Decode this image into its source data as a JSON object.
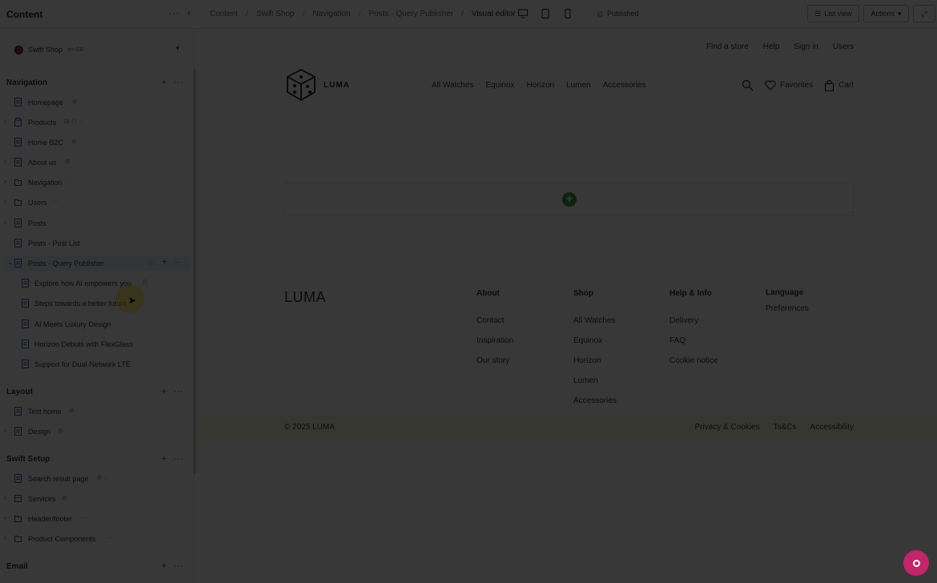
{
  "topbar": {
    "title": "Content",
    "breadcrumbs": [
      "Content",
      "Swift Shop",
      "Navigation",
      "Posts - Query Publisher",
      "Visual editor"
    ],
    "status": "Published",
    "list_view_label": "List view",
    "actions_label": "Actions"
  },
  "sidebar": {
    "site": {
      "name": "Swift Shop",
      "lang": "en-GB"
    },
    "sections": [
      {
        "label": "Navigation"
      },
      {
        "label": "Layout"
      },
      {
        "label": "Swift Setup"
      },
      {
        "label": "Email"
      }
    ],
    "items": [
      {
        "label": "Homepage",
        "icon": "page-icon"
      },
      {
        "label": "Products",
        "icon": "shop-icon"
      },
      {
        "label": "Home B2C",
        "icon": "page-icon"
      },
      {
        "label": "About us",
        "icon": "page-icon"
      },
      {
        "label": "Navigation",
        "icon": "folder-icon"
      },
      {
        "label": "Users",
        "icon": "folder-icon"
      },
      {
        "label": "Posts",
        "icon": "page-icon"
      },
      {
        "label": "Posts - Post List",
        "icon": "page-icon"
      },
      {
        "label": "Posts - Query Publisher",
        "icon": "page-icon"
      },
      {
        "label": "Explore how AI empowers you",
        "icon": "page-icon"
      },
      {
        "label": "Steps towards a better future",
        "icon": "page-icon"
      },
      {
        "label": "AI Meets Luxury Design",
        "icon": "page-icon"
      },
      {
        "label": "Horizon Debuts with FlexGlass",
        "icon": "page-icon"
      },
      {
        "label": "Support for Dual-Network LTE",
        "icon": "page-icon"
      },
      {
        "label": "Test home",
        "icon": "page-icon"
      },
      {
        "label": "Design",
        "icon": "page-icon"
      },
      {
        "label": "Search result page",
        "icon": "page-icon"
      },
      {
        "label": "Services",
        "icon": "services-icon"
      },
      {
        "label": "Header/footer",
        "icon": "folder-icon"
      },
      {
        "label": "Product Components",
        "icon": "folder-icon"
      }
    ]
  },
  "preview": {
    "utility_links": [
      "Find a store",
      "Help",
      "Sign in",
      "Users"
    ],
    "brand": "LUMA",
    "nav": [
      "All Watches",
      "Equinox",
      "Horizon",
      "Lumen",
      "Accessories"
    ],
    "favorites_label": "Favorites",
    "cart_label": "Cart",
    "footer": {
      "brand": "LUMA",
      "columns": [
        {
          "heading": "About",
          "links": [
            "Contact",
            "Inspiration",
            "Our story"
          ]
        },
        {
          "heading": "Shop",
          "links": [
            "All Watches",
            "Equinox",
            "Horizon",
            "Lumen",
            "Accessories"
          ]
        },
        {
          "heading": "Help & Info",
          "links": [
            "Delivery",
            "FAQ",
            "Cookie notice"
          ]
        },
        {
          "heading": "Language",
          "links": [
            "Preferences"
          ]
        }
      ],
      "copyright": "© 2025 LUMA",
      "legal": [
        "Privacy & Cookies",
        "Ts&Cs",
        "Accessibility"
      ]
    }
  },
  "colors": {
    "overlay": "#000000",
    "add_button": "#3c9a51",
    "chat_bubble": "#c4246a",
    "copyright_bar": "#fbf8e2"
  }
}
